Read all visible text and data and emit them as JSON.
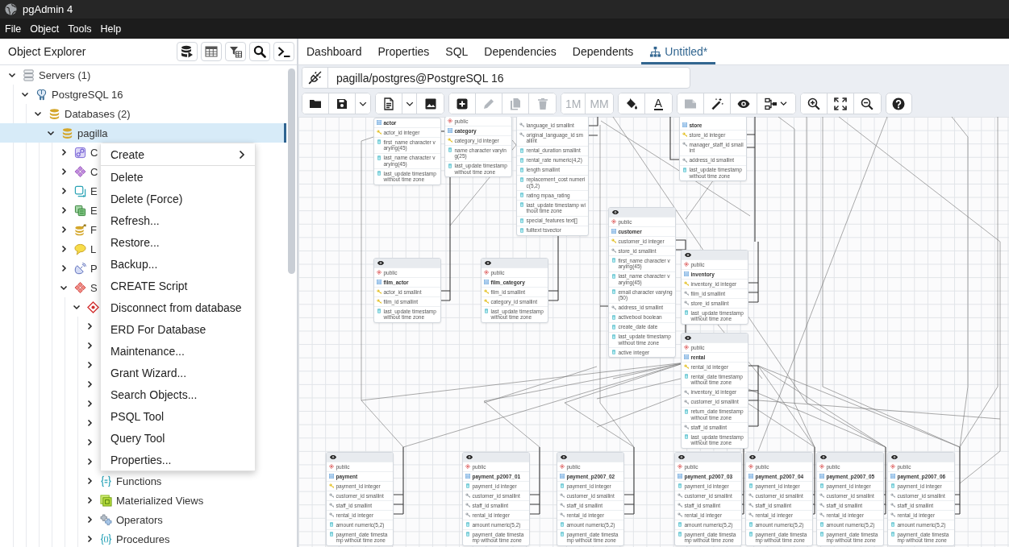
{
  "window": {
    "title": "pgAdmin 4"
  },
  "menu_bar": [
    "File",
    "Object",
    "Tools",
    "Help"
  ],
  "object_explorer": {
    "title": "Object Explorer",
    "tree": [
      {
        "label": "Servers (1)",
        "kind": "server-group",
        "expanded": true,
        "selected": false,
        "children": [
          {
            "label": "PostgreSQL 16",
            "kind": "server",
            "expanded": true,
            "selected": false,
            "children": [
              {
                "label": "Databases (2)",
                "kind": "databases",
                "expanded": true,
                "selected": false,
                "children": [
                  {
                    "label": "pagilla",
                    "kind": "database",
                    "expanded": true,
                    "selected": true,
                    "children": [
                      {
                        "label": "C",
                        "kind": "casts",
                        "expanded": false,
                        "selected": false
                      },
                      {
                        "label": "C",
                        "kind": "catalogs",
                        "expanded": false,
                        "selected": false
                      },
                      {
                        "label": "E",
                        "kind": "event-triggers",
                        "expanded": false,
                        "selected": false
                      },
                      {
                        "label": "E",
                        "kind": "extensions",
                        "expanded": false,
                        "selected": false
                      },
                      {
                        "label": "F",
                        "kind": "foreign-data-wrappers",
                        "expanded": false,
                        "selected": false
                      },
                      {
                        "label": "L",
                        "kind": "languages",
                        "expanded": false,
                        "selected": false
                      },
                      {
                        "label": "P",
                        "kind": "publications",
                        "expanded": false,
                        "selected": false
                      },
                      {
                        "label": "S",
                        "kind": "schemas",
                        "expanded": true,
                        "selected": false,
                        "children": [
                          {
                            "kind": "schema",
                            "expanded": true,
                            "selected": false,
                            "children": [
                              {
                                "expanded": false,
                                "selected": false
                              },
                              {
                                "expanded": false,
                                "selected": false
                              },
                              {
                                "expanded": false,
                                "selected": false
                              },
                              {
                                "expanded": false,
                                "selected": false
                              },
                              {
                                "expanded": false,
                                "selected": false
                              },
                              {
                                "expanded": false,
                                "selected": false
                              },
                              {
                                "expanded": false,
                                "selected": false
                              },
                              {
                                "expanded": false,
                                "selected": false
                              },
                              {
                                "label": "Functions",
                                "kind": "functions",
                                "expanded": false,
                                "selected": false
                              },
                              {
                                "label": "Materialized Views",
                                "kind": "materialized-views",
                                "expanded": false,
                                "selected": false
                              },
                              {
                                "label": "Operators",
                                "kind": "operators",
                                "expanded": false,
                                "selected": false
                              },
                              {
                                "label": "Procedures",
                                "kind": "procedures",
                                "expanded": false,
                                "selected": false
                              }
                            ]
                          }
                        ]
                      }
                    ]
                  }
                ]
              }
            ]
          }
        ]
      }
    ]
  },
  "context_menu": [
    {
      "kind": "submenu",
      "label": "Create"
    },
    {
      "kind": "separator"
    },
    {
      "kind": "item",
      "label": "Delete"
    },
    {
      "kind": "item",
      "label": "Delete (Force)"
    },
    {
      "kind": "item",
      "label": "Refresh..."
    },
    {
      "kind": "item",
      "label": "Restore..."
    },
    {
      "kind": "item",
      "label": "Backup..."
    },
    {
      "kind": "item",
      "label": "CREATE Script"
    },
    {
      "kind": "item",
      "label": "Disconnect from database"
    },
    {
      "kind": "item",
      "label": "ERD For Database"
    },
    {
      "kind": "item",
      "label": "Maintenance..."
    },
    {
      "kind": "item",
      "label": "Grant Wizard..."
    },
    {
      "kind": "item",
      "label": "Search Objects..."
    },
    {
      "kind": "item",
      "label": "PSQL Tool"
    },
    {
      "kind": "item",
      "label": "Query Tool"
    },
    {
      "kind": "item",
      "label": "Properties..."
    }
  ],
  "tabs": [
    {
      "label": "Dashboard",
      "kind": "panel",
      "selected": false
    },
    {
      "label": "Properties",
      "kind": "panel",
      "selected": false
    },
    {
      "label": "SQL",
      "kind": "panel",
      "selected": false
    },
    {
      "label": "Dependencies",
      "kind": "panel",
      "selected": false
    },
    {
      "label": "Dependents",
      "kind": "panel",
      "selected": false
    },
    {
      "label": "Untitled*",
      "kind": "erd",
      "selected": true
    }
  ],
  "erd": {
    "connection": "pagilla/postgres@PostgreSQL 16",
    "toolbar": [
      [
        {
          "kind": "icon",
          "disabled": false
        },
        {
          "kind": "icon",
          "disabled": false
        },
        {
          "kind": "caret",
          "disabled": false
        }
      ],
      [
        {
          "kind": "icon",
          "disabled": false
        },
        {
          "kind": "caret",
          "disabled": false
        },
        {
          "kind": "icon",
          "disabled": false
        }
      ],
      [
        {
          "kind": "icon",
          "disabled": false
        },
        {
          "kind": "icon",
          "disabled": true
        },
        {
          "kind": "icon",
          "disabled": true
        },
        {
          "kind": "icon",
          "disabled": true
        }
      ],
      [
        {
          "kind": "text",
          "label": "1M",
          "disabled": true
        },
        {
          "kind": "text",
          "label": "MM",
          "disabled": true
        }
      ],
      [
        {
          "kind": "icon",
          "disabled": false
        },
        {
          "kind": "text-color",
          "label": "A",
          "disabled": false
        }
      ],
      [
        {
          "kind": "icon",
          "disabled": true
        },
        {
          "kind": "icon",
          "disabled": false
        },
        {
          "kind": "icon",
          "disabled": false
        },
        {
          "kind": "icon-menu",
          "disabled": false
        }
      ],
      [
        {
          "kind": "icon",
          "disabled": false
        },
        {
          "kind": "icon",
          "disabled": false
        },
        {
          "kind": "icon",
          "disabled": false
        }
      ],
      [
        {
          "kind": "icon",
          "disabled": false
        }
      ]
    ],
    "tables": [
      {
        "name": "actor",
        "columns": [
          {
            "kind": "pk",
            "label": "actor_id integer"
          },
          {
            "kind": "column",
            "label": "first_name character varying(45)"
          },
          {
            "kind": "column",
            "label": "last_name character varying(45)"
          },
          {
            "kind": "column",
            "label": "last_update timestamp without time zone"
          }
        ]
      },
      {
        "schema": "public",
        "name": "category",
        "columns": [
          {
            "kind": "pk",
            "label": "category_id integer"
          },
          {
            "kind": "column",
            "label": "name character varying(25)"
          },
          {
            "kind": "column",
            "label": "last_update timestamp without time zone"
          }
        ]
      },
      {
        "columns": [
          {
            "kind": "fk",
            "label": "language_id smallint"
          },
          {
            "kind": "fk",
            "label": "original_language_id smallint"
          },
          {
            "kind": "column",
            "label": "rental_duration smallint"
          },
          {
            "kind": "column",
            "label": "rental_rate numeric(4,2)"
          },
          {
            "kind": "column",
            "label": "length smallint"
          },
          {
            "kind": "column",
            "label": "replacement_cost numeric(5,2)"
          },
          {
            "kind": "column",
            "label": "rating mpaa_rating"
          },
          {
            "kind": "column",
            "label": "last_update timestamp without time zone"
          },
          {
            "kind": "column",
            "label": "special_features text[]"
          },
          {
            "kind": "column",
            "label": "fulltext tsvector"
          }
        ]
      },
      {
        "name": "store",
        "columns": [
          {
            "kind": "pk",
            "label": "store_id integer"
          },
          {
            "kind": "fk",
            "label": "manager_staff_id smallint"
          },
          {
            "kind": "fk",
            "label": "address_id smallint"
          },
          {
            "kind": "column",
            "label": "last_update timestamp without time zone"
          }
        ]
      },
      {
        "schema": "public",
        "name": "film_actor",
        "columns": [
          {
            "kind": "pk",
            "label": "actor_id smallint"
          },
          {
            "kind": "pk",
            "label": "film_id smallint"
          },
          {
            "kind": "column",
            "label": "last_update timestamp without time zone"
          }
        ]
      },
      {
        "schema": "public",
        "name": "film_category",
        "columns": [
          {
            "kind": "pk",
            "label": "film_id smallint"
          },
          {
            "kind": "pk",
            "label": "category_id smallint"
          },
          {
            "kind": "column",
            "label": "last_update timestamp without time zone"
          }
        ]
      },
      {
        "schema": "public",
        "name": "customer",
        "columns": [
          {
            "kind": "pk",
            "label": "customer_id integer"
          },
          {
            "kind": "fk",
            "label": "store_id smallint"
          },
          {
            "kind": "column",
            "label": "first_name character varying(45)"
          },
          {
            "kind": "column",
            "label": "last_name character varying(45)"
          },
          {
            "kind": "column",
            "label": "email character varying(50)"
          },
          {
            "kind": "fk",
            "label": "address_id smallint"
          },
          {
            "kind": "column",
            "label": "activebool boolean"
          },
          {
            "kind": "column",
            "label": "create_date date"
          },
          {
            "kind": "column",
            "label": "last_update timestamp without time zone"
          },
          {
            "kind": "column",
            "label": "active integer"
          }
        ]
      },
      {
        "schema": "public",
        "name": "inventory",
        "columns": [
          {
            "kind": "pk",
            "label": "inventory_id integer"
          },
          {
            "kind": "fk",
            "label": "film_id smallint"
          },
          {
            "kind": "fk",
            "label": "store_id smallint"
          },
          {
            "kind": "column",
            "label": "last_update timestamp without time zone"
          }
        ]
      },
      {
        "schema": "public",
        "name": "rental",
        "columns": [
          {
            "kind": "pk",
            "label": "rental_id integer"
          },
          {
            "kind": "column",
            "label": "rental_date timestamp without time zone"
          },
          {
            "kind": "fk",
            "label": "inventory_id integer"
          },
          {
            "kind": "fk",
            "label": "customer_id smallint"
          },
          {
            "kind": "column",
            "label": "return_date timestamp without time zone"
          },
          {
            "kind": "fk",
            "label": "staff_id smallint"
          },
          {
            "kind": "column",
            "label": "last_update timestamp without time zone"
          }
        ]
      },
      {
        "schema": "public",
        "name": "payment",
        "columns": [
          {
            "kind": "pk",
            "label": "payment_id integer"
          },
          {
            "kind": "fk",
            "label": "customer_id smallint"
          },
          {
            "kind": "fk",
            "label": "staff_id smallint"
          },
          {
            "kind": "fk",
            "label": "rental_id integer"
          },
          {
            "kind": "column",
            "label": "amount numeric(5,2)"
          },
          {
            "kind": "column",
            "label": "payment_date timestamp without time zone"
          }
        ]
      },
      {
        "schema": "public",
        "name": "payment_p2007_01",
        "columns": [
          {
            "kind": "column",
            "label": "payment_id integer"
          },
          {
            "kind": "fk",
            "label": "customer_id smallint"
          },
          {
            "kind": "fk",
            "label": "staff_id smallint"
          },
          {
            "kind": "fk",
            "label": "rental_id integer"
          },
          {
            "kind": "column",
            "label": "amount numeric(5,2)"
          },
          {
            "kind": "column",
            "label": "payment_date timestamp without time zone"
          }
        ]
      },
      {
        "schema": "public",
        "name": "payment_p2007_02",
        "columns": [
          {
            "kind": "column",
            "label": "payment_id integer"
          },
          {
            "kind": "fk",
            "label": "customer_id smallint"
          },
          {
            "kind": "fk",
            "label": "staff_id smallint"
          },
          {
            "kind": "fk",
            "label": "rental_id integer"
          },
          {
            "kind": "column",
            "label": "amount numeric(5,2)"
          },
          {
            "kind": "column",
            "label": "payment_date timestamp without time zone"
          }
        ]
      },
      {
        "schema": "public",
        "name": "payment_p2007_03",
        "columns": [
          {
            "kind": "column",
            "label": "payment_id integer"
          },
          {
            "kind": "fk",
            "label": "customer_id smallint"
          },
          {
            "kind": "fk",
            "label": "staff_id smallint"
          },
          {
            "kind": "fk",
            "label": "rental_id integer"
          },
          {
            "kind": "column",
            "label": "amount numeric(5,2)"
          },
          {
            "kind": "column",
            "label": "payment_date timestamp without time zone"
          }
        ]
      },
      {
        "schema": "public",
        "name": "payment_p2007_04",
        "columns": [
          {
            "kind": "column",
            "label": "payment_id integer"
          },
          {
            "kind": "fk",
            "label": "customer_id smallint"
          },
          {
            "kind": "fk",
            "label": "staff_id smallint"
          },
          {
            "kind": "fk",
            "label": "rental_id integer"
          },
          {
            "kind": "column",
            "label": "amount numeric(5,2)"
          },
          {
            "kind": "column",
            "label": "payment_date timestamp without time zone"
          }
        ]
      },
      {
        "schema": "public",
        "name": "payment_p2007_05",
        "columns": [
          {
            "kind": "column",
            "label": "payment_id integer"
          },
          {
            "kind": "fk",
            "label": "customer_id smallint"
          },
          {
            "kind": "fk",
            "label": "staff_id smallint"
          },
          {
            "kind": "fk",
            "label": "rental_id integer"
          },
          {
            "kind": "column",
            "label": "amount numeric(5,2)"
          },
          {
            "kind": "column",
            "label": "payment_date timestamp without time zone"
          }
        ]
      },
      {
        "schema": "public",
        "name": "payment_p2007_06",
        "columns": [
          {
            "kind": "column",
            "label": "payment_id integer"
          },
          {
            "kind": "fk",
            "label": "customer_id smallint"
          },
          {
            "kind": "fk",
            "label": "staff_id smallint"
          },
          {
            "kind": "fk",
            "label": "rental_id integer"
          },
          {
            "kind": "column",
            "label": "amount numeric(5,2)"
          },
          {
            "kind": "column",
            "label": "payment_date timestamp without time zone"
          }
        ]
      }
    ]
  }
}
